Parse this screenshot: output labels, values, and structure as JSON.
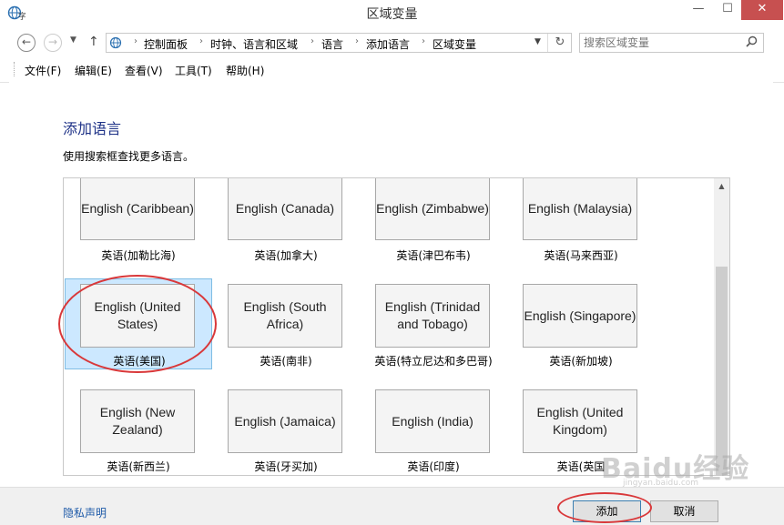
{
  "window": {
    "title": "区域变量",
    "app_icon": "globe-language-icon",
    "controls": {
      "minimize": "—",
      "maximize": "☐",
      "close": "✕"
    }
  },
  "navigation": {
    "back_icon": "←",
    "forward_icon": "→",
    "history_icon": "▼",
    "up_icon": "↑",
    "breadcrumb": [
      "控制面板",
      "时钟、语言和区域",
      "语言",
      "添加语言",
      "区域变量"
    ],
    "breadcrumb_separator": "›",
    "address_dropdown_icon": "▼",
    "refresh_icon": "↻",
    "search_placeholder": "搜索区域变量",
    "search_icon": "⌕"
  },
  "menu": {
    "items": [
      "文件(F)",
      "编辑(E)",
      "查看(V)",
      "工具(T)",
      "帮助(H)"
    ]
  },
  "main": {
    "heading": "添加语言",
    "instruction": "使用搜索框查找更多语言。",
    "languages": [
      {
        "name": "English (Caribbean)",
        "caption": "英语(加勒比海)",
        "selected": false
      },
      {
        "name": "English (Canada)",
        "caption": "英语(加拿大)",
        "selected": false
      },
      {
        "name": "English (Zimbabwe)",
        "caption": "英语(津巴布韦)",
        "selected": false
      },
      {
        "name": "English (Malaysia)",
        "caption": "英语(马来西亚)",
        "selected": false
      },
      {
        "name": "English (United States)",
        "caption": "英语(美国)",
        "selected": true
      },
      {
        "name": "English (South Africa)",
        "caption": "英语(南非)",
        "selected": false
      },
      {
        "name": "English (Trinidad and Tobago)",
        "caption": "英语(特立尼达和多巴哥)",
        "selected": false
      },
      {
        "name": "English (Singapore)",
        "caption": "英语(新加坡)",
        "selected": false
      },
      {
        "name": "English (New Zealand)",
        "caption": "英语(新西兰)",
        "selected": false
      },
      {
        "name": "English (Jamaica)",
        "caption": "英语(牙买加)",
        "selected": false
      },
      {
        "name": "English (India)",
        "caption": "英语(印度)",
        "selected": false
      },
      {
        "name": "English (United Kingdom)",
        "caption": "英语(英国",
        "selected": false
      }
    ],
    "scroll_up_icon": "▲"
  },
  "footer": {
    "privacy_link": "隐私声明",
    "add_button": "添加",
    "cancel_button": "取消"
  },
  "annotations": {
    "color": "#d9383a"
  },
  "watermark": {
    "text": "Baidu经验",
    "sub": "jingyan.baidu.com"
  }
}
